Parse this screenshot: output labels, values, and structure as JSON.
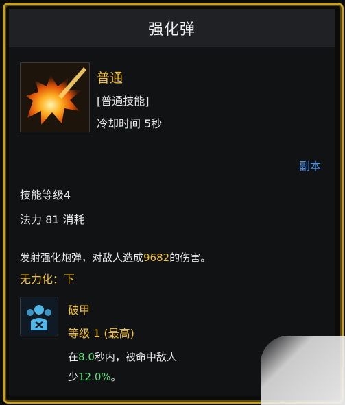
{
  "header": {
    "title": "强化弹"
  },
  "skill": {
    "icon": "explosion-icon",
    "name": "普通",
    "type_tag": "[普通技能]",
    "cooldown": "冷却时间 5秒",
    "dungeon_link": "副本",
    "level": "技能等级4",
    "mana_cost": "法力 81 消耗"
  },
  "description": {
    "prefix": "发射强化炮弹，对敌人造成",
    "damage": "9682",
    "suffix": "的伤害。",
    "disable": "无力化：下"
  },
  "buff": {
    "icon": "armor-break-icon",
    "name": "破甲",
    "level": "等级 1 (最高)",
    "desc_prefix": "在",
    "duration": "8.0",
    "desc_middle": "秒内，被命中敌人",
    "desc_line2_prefix": "少",
    "percent": "12.0%",
    "desc_line2_suffix": "。"
  },
  "colors": {
    "gold": "#f2c234",
    "link": "#4b8fe6",
    "green": "#5ee07a",
    "frame": "#c9a21b"
  }
}
